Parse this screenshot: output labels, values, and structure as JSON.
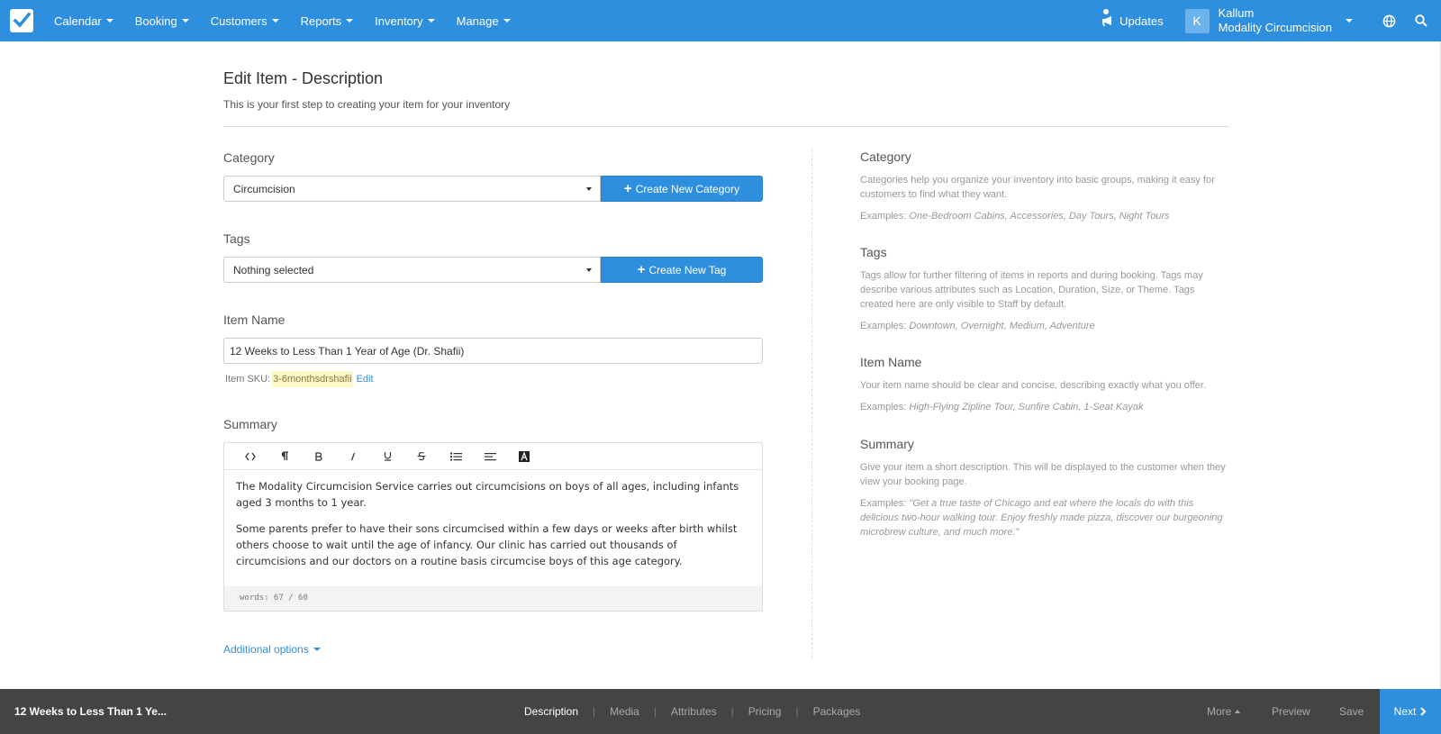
{
  "nav": {
    "items": [
      {
        "label": "Calendar"
      },
      {
        "label": "Booking"
      },
      {
        "label": "Customers"
      },
      {
        "label": "Reports"
      },
      {
        "label": "Inventory"
      },
      {
        "label": "Manage"
      }
    ],
    "updates_label": "Updates",
    "user": {
      "initial": "K",
      "name": "Kallum",
      "company": "Modality Circumcision"
    }
  },
  "page": {
    "title": "Edit Item - Description",
    "subtitle": "This is your first step to creating your item for your inventory"
  },
  "form": {
    "category": {
      "label": "Category",
      "value": "Circumcision",
      "button": "Create New Category"
    },
    "tags": {
      "label": "Tags",
      "value": "Nothing selected",
      "button": "Create New Tag"
    },
    "item_name": {
      "label": "Item Name",
      "value": "12 Weeks to Less Than 1 Year of Age (Dr. Shafii)"
    },
    "sku": {
      "label": "Item SKU:",
      "value": "3-6monthsdrshafii",
      "edit": "Edit"
    },
    "summary": {
      "label": "Summary",
      "paragraphs": [
        "The Modality Circumcision Service carries out circumcisions on boys of all ages, including infants aged 3 months to 1 year.",
        "Some parents prefer to have their sons circumcised within a few days or weeks after birth whilst others choose to wait until the age of infancy. Our clinic has carried out thousands of circumcisions and our doctors on a routine basis circumcise boys of this age category."
      ],
      "word_count": "words: 67 / 60"
    },
    "additional_options": "Additional options"
  },
  "help": {
    "category": {
      "title": "Category",
      "desc": "Categories help you organize your inventory into basic groups, making it easy for customers to find what they want.",
      "ex_label": "Examples: ",
      "ex": "One-Bedroom Cabins, Accessories, Day Tours, Night Tours"
    },
    "tags": {
      "title": "Tags",
      "desc": "Tags allow for further filtering of items in reports and during booking. Tags may describe various attributes such as Location, Duration, Size, or Theme. Tags created here are only visible to Staff by default.",
      "ex_label": "Examples: ",
      "ex": "Downtown, Overnight, Medium, Adventure"
    },
    "item_name": {
      "title": "Item Name",
      "desc": "Your item name should be clear and concise, describing exactly what you offer.",
      "ex_label": "Examples: ",
      "ex": "High-Flying Zipline Tour, Sunfire Cabin, 1-Seat Kayak"
    },
    "summary": {
      "title": "Summary",
      "desc": "Give your item a short description. This will be displayed to the customer when they view your booking page.",
      "ex_label": "Examples: ",
      "ex": "\"Get a true taste of Chicago and eat where the locals do with this delicious two-hour walking tour. Enjoy freshly made pizza, discover our burgeoning microbrew culture, and much more.\""
    }
  },
  "footer": {
    "item_title": "12 Weeks to Less Than 1 Ye...",
    "tabs": [
      "Description",
      "Media",
      "Attributes",
      "Pricing",
      "Packages"
    ],
    "more": "More",
    "preview": "Preview",
    "save": "Save",
    "next": "Next"
  },
  "colors": {
    "brand": "#2d8fdd",
    "footer_bg": "#444444",
    "sku_highlight": "#fcf8c8"
  }
}
